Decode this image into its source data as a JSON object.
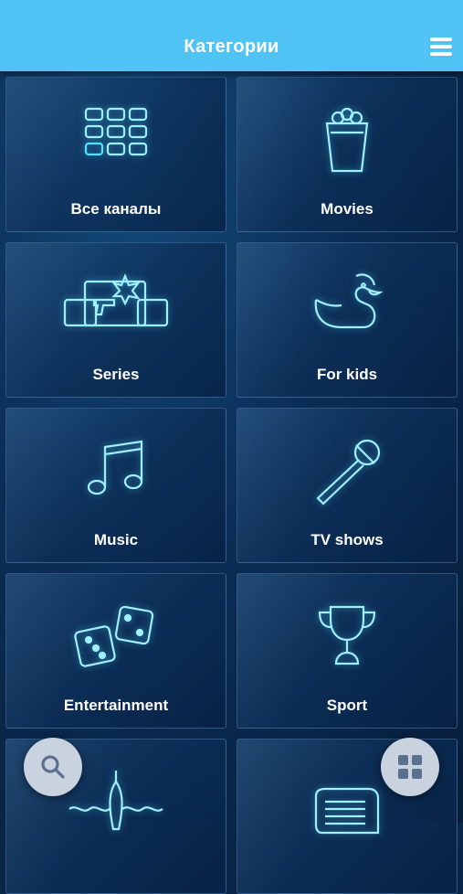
{
  "header": {
    "title": "Категории"
  },
  "categories": [
    {
      "label": "Все каналы",
      "icon": "grid-channels-icon"
    },
    {
      "label": "Movies",
      "icon": "popcorn-icon"
    },
    {
      "label": "Series",
      "icon": "screens-gun-icon"
    },
    {
      "label": "For kids",
      "icon": "rubber-duck-icon"
    },
    {
      "label": "Music",
      "icon": "music-note-icon"
    },
    {
      "label": "TV shows",
      "icon": "microphone-icon"
    },
    {
      "label": "Entertainment",
      "icon": "dice-icon"
    },
    {
      "label": "Sport",
      "icon": "trophy-icon"
    },
    {
      "label": "",
      "icon": "fishing-float-icon"
    },
    {
      "label": "",
      "icon": "newspaper-icon"
    }
  ],
  "colors": {
    "header": "#4ec3f4",
    "neon": "#9ff0ff",
    "background": "#0b2d55",
    "fab": "#c9d3df",
    "fab_icon": "#5b6f8f"
  }
}
